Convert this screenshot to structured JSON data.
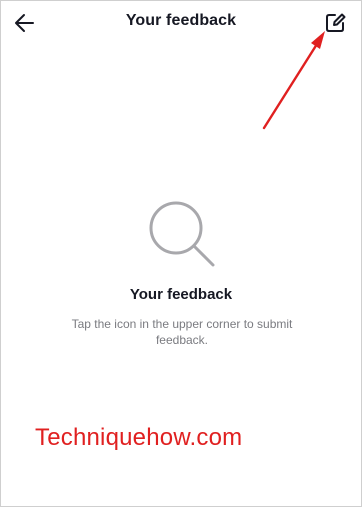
{
  "header": {
    "title": "Your feedback",
    "back_icon": "arrow-left-icon",
    "edit_icon": "edit-square-icon"
  },
  "annotation": {
    "color": "#e02020"
  },
  "empty_state": {
    "icon": "magnifier-icon",
    "title": "Your feedback",
    "description": "Tap the icon in the upper corner to submit feedback."
  },
  "watermark": {
    "text": "Techniquehow.com",
    "color": "#e02020"
  }
}
